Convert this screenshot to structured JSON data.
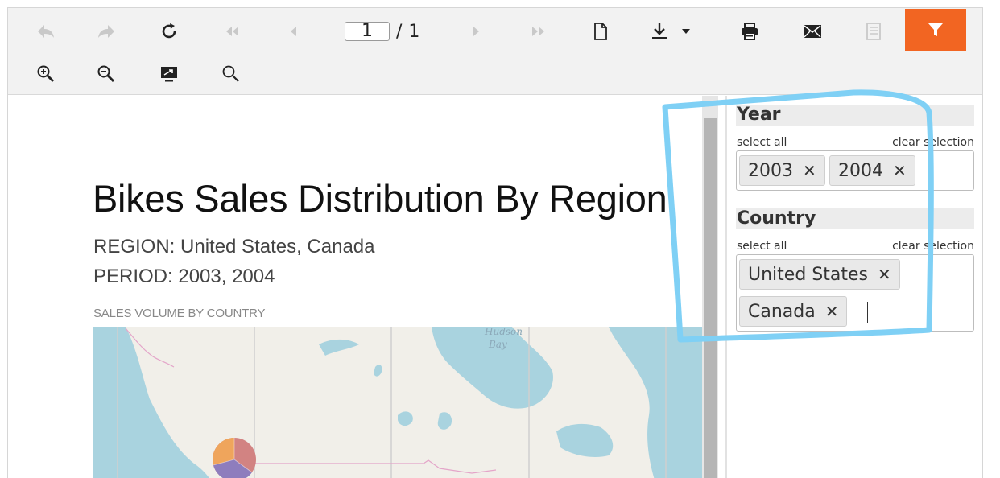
{
  "toolbar": {
    "page_current": "1",
    "page_separator": "/",
    "page_total": "1",
    "buttons": [
      {
        "name": "back-icon"
      },
      {
        "name": "forward-icon"
      },
      {
        "name": "refresh-icon"
      },
      {
        "name": "first-page-icon"
      },
      {
        "name": "prev-page-icon"
      },
      {
        "name": "next-page-icon"
      },
      {
        "name": "last-page-icon"
      },
      {
        "name": "document-icon"
      },
      {
        "name": "download-icon"
      },
      {
        "name": "print-icon"
      },
      {
        "name": "email-icon"
      },
      {
        "name": "report-icon"
      },
      {
        "name": "filter-icon"
      },
      {
        "name": "zoom-in-icon"
      },
      {
        "name": "zoom-out-icon"
      },
      {
        "name": "fullscreen-icon"
      },
      {
        "name": "search-icon"
      }
    ],
    "accent_color": "#f26522"
  },
  "report": {
    "title": "Bikes Sales Distribution By Region",
    "region_line": "REGION: United States, Canada",
    "period_line": "PERIOD: 2003, 2004",
    "map_caption": "SALES VOLUME BY COUNTRY",
    "map_label_line1": "Hudson",
    "map_label_line2": "Bay"
  },
  "filters": {
    "year": {
      "heading": "Year",
      "select_all": "select all",
      "clear_selection": "clear selection",
      "tags": [
        "2003",
        "2004"
      ]
    },
    "country": {
      "heading": "Country",
      "select_all": "select all",
      "clear_selection": "clear selection",
      "tags": [
        "United States",
        "Canada"
      ]
    },
    "remove_glyph": "✕"
  },
  "annotation_color": "#7fd0f5"
}
